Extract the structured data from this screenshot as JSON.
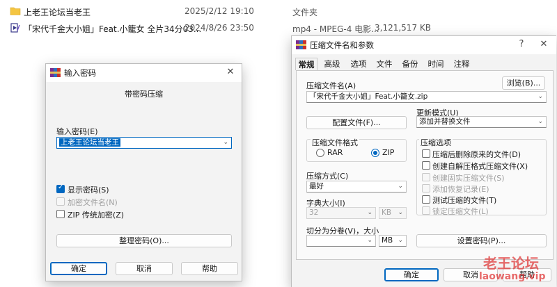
{
  "explorer": {
    "rows": [
      {
        "name": "上老王论坛当老王",
        "date": "2025/2/12 19:10",
        "type": "文件夹",
        "size": "",
        "icon": "folder-icon"
      },
      {
        "name": "「宋代千金大小姐」Feat.小籠女 全片34分03...",
        "date": "2024/8/26 23:50",
        "type": "mp4 - MPEG-4 电影...",
        "size": "3,121,517 KB",
        "icon": "video-file-icon"
      }
    ]
  },
  "password_dialog": {
    "title": "输入密码",
    "subtitle": "带密码压缩",
    "password_label": "输入密码(E)",
    "password_value": "上老王论坛当老王",
    "show_password": {
      "label": "显示密码(S)",
      "checked": true
    },
    "encrypt_names": {
      "label": "加密文件名(N)",
      "checked": false,
      "disabled": true
    },
    "zip_legacy": {
      "label": "ZIP 传统加密(Z)",
      "checked": false
    },
    "organize_button": "整理密码(O)...",
    "ok_button": "确定",
    "cancel_button": "取消",
    "help_button": "帮助",
    "close_glyph": "✕"
  },
  "archive_dialog": {
    "title": "压缩文件名和参数",
    "help_glyph": "?",
    "close_glyph": "✕",
    "tabs": [
      "常规",
      "高级",
      "选项",
      "文件",
      "备份",
      "时间",
      "注释"
    ],
    "active_tab": "常规",
    "archive_name_label": "压缩文件名(A)",
    "archive_name_value": "「宋代千金大小姐」Feat.小籠女.zip",
    "browse_button": "浏览(B)...",
    "profiles_button": "配置文件(F)...",
    "update_mode_label": "更新模式(U)",
    "update_mode_value": "添加并替换文件",
    "format_group_label": "压缩文件格式",
    "format_rar": "RAR",
    "format_zip": "ZIP",
    "format_selected": "ZIP",
    "options_group_label": "压缩选项",
    "options": [
      {
        "label": "压缩后删除原来的文件(D)",
        "checked": false,
        "disabled": false
      },
      {
        "label": "创建自解压格式压缩文件(X)",
        "checked": false,
        "disabled": false
      },
      {
        "label": "创建固实压缩文件(S)",
        "checked": false,
        "disabled": true
      },
      {
        "label": "添加恢复记录(E)",
        "checked": false,
        "disabled": true
      },
      {
        "label": "测试压缩的文件(T)",
        "checked": false,
        "disabled": false
      },
      {
        "label": "锁定压缩文件(L)",
        "checked": false,
        "disabled": true
      }
    ],
    "method_label": "压缩方式(C)",
    "method_value": "最好",
    "dict_label": "字典大小(I)",
    "dict_value": "32",
    "dict_unit": "KB",
    "split_label": "切分为分卷(V)，大小",
    "split_value": "",
    "split_unit": "MB",
    "set_password_button": "设置密码(P)...",
    "ok_button": "确定",
    "cancel_button": "取消",
    "help_button": "帮助"
  },
  "watermark": {
    "line1": "老王论坛",
    "line2": "laowang.vip"
  },
  "colors": {
    "accent": "#0067c0",
    "watermark": "#e03a3a",
    "folder": "#f4c542"
  }
}
